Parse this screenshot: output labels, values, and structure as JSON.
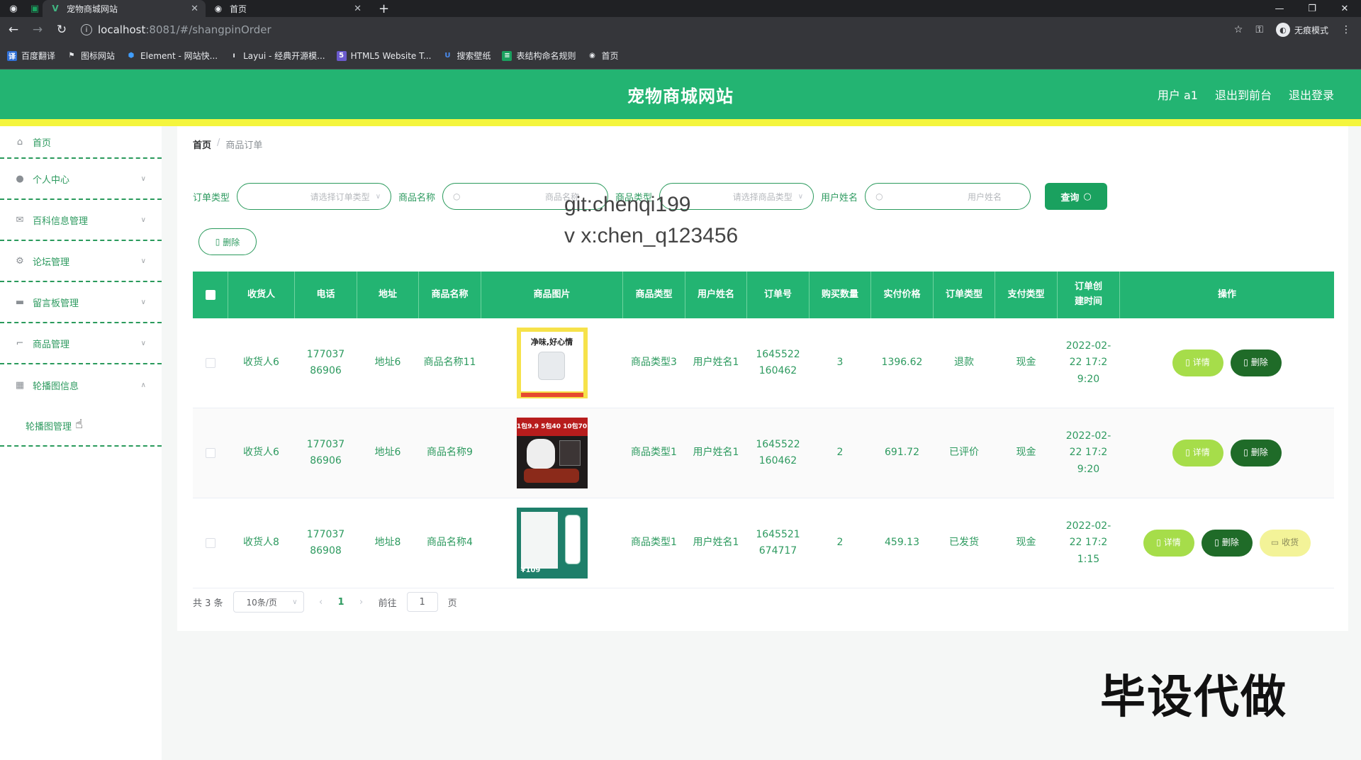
{
  "browser": {
    "tabs": [
      {
        "title": "宠物商城网站",
        "active": true
      },
      {
        "title": "首页",
        "active": false
      }
    ],
    "url_host": "localhost",
    "url_path": ":8081/#/shangpinOrder",
    "profile_label": "无痕模式",
    "bookmarks": [
      "百度翻译",
      "图标网站",
      "Element - 网站快...",
      "Layui - 经典开源模...",
      "HTML5 Website T...",
      "搜索壁纸",
      "表结构命名规则",
      "首页"
    ]
  },
  "header": {
    "title": "宠物商城网站",
    "user": "用户 a1",
    "to_front": "退出到前台",
    "logout": "退出登录"
  },
  "sidebar": {
    "items": [
      {
        "label": "首页",
        "icon": "home-icon"
      },
      {
        "label": "个人中心",
        "icon": "user-icon"
      },
      {
        "label": "百科信息管理",
        "icon": "mail-icon"
      },
      {
        "label": "论坛管理",
        "icon": "settings-icon"
      },
      {
        "label": "留言板管理",
        "icon": "briefcase-icon"
      },
      {
        "label": "商品管理",
        "icon": "crop-icon"
      },
      {
        "label": "轮播图信息",
        "icon": "grid-icon"
      }
    ],
    "sub_item": "轮播图管理"
  },
  "breadcrumb": {
    "home": "首页",
    "sep": "/",
    "current": "商品订单"
  },
  "filters": {
    "order_type_label": "订单类型",
    "order_type_placeholder": "请选择订单类型",
    "product_name_label": "商品名称",
    "product_name_placeholder": "商品名称",
    "product_type_label": "商品类型",
    "product_type_placeholder": "请选择商品类型",
    "username_label": "用户姓名",
    "username_placeholder": "用户姓名",
    "query_button": "查询"
  },
  "delete_button": "删除",
  "watermark": {
    "line1": "git:chenqi199",
    "line2": "v x:chen_q123456"
  },
  "table": {
    "headers": [
      "收货人",
      "电话",
      "地址",
      "商品名称",
      "商品图片",
      "商品类型",
      "用户姓名",
      "订单号",
      "购买数量",
      "实付价格",
      "订单类型",
      "支付类型",
      "订单创建时间",
      "操作"
    ],
    "rows": [
      {
        "receiver": "收货人6",
        "phone": "17703786906",
        "address": "地址6",
        "product": "商品名称11",
        "img_text": "净味,好心情",
        "type": "商品类型3",
        "user": "用户姓名1",
        "order_no": "1645522160462",
        "qty": "3",
        "price": "1396.62",
        "order_type": "退款",
        "pay_type": "现金",
        "created": "2022-02-22 17:29:20"
      },
      {
        "receiver": "收货人6",
        "phone": "17703786906",
        "address": "地址6",
        "product": "商品名称9",
        "img_text": "1包9.9 5包40 10包70",
        "type": "商品类型1",
        "user": "用户姓名1",
        "order_no": "1645522160462",
        "qty": "2",
        "price": "691.72",
        "order_type": "已评价",
        "pay_type": "现金",
        "created": "2022-02-22 17:29:20"
      },
      {
        "receiver": "收货人8",
        "phone": "17703786908",
        "address": "地址8",
        "product": "商品名称4",
        "img_text": "¥109",
        "type": "商品类型1",
        "user": "用户姓名1",
        "order_no": "1645521674717",
        "qty": "2",
        "price": "459.13",
        "order_type": "已发货",
        "pay_type": "现金",
        "created": "2022-02-22 17:21:15"
      }
    ],
    "actions": {
      "detail": "详情",
      "delete": "删除",
      "receive": "收货"
    }
  },
  "pagination": {
    "total": "共 3 条",
    "page_size": "10条/页",
    "current": "1",
    "goto_label": "前往",
    "goto_value": "1",
    "page_unit": "页"
  },
  "overlay_text": "毕设代做",
  "colors": {
    "primary": "#23b472",
    "accent_yellow": "#f4f53d",
    "text_green": "#2d9a5f"
  }
}
